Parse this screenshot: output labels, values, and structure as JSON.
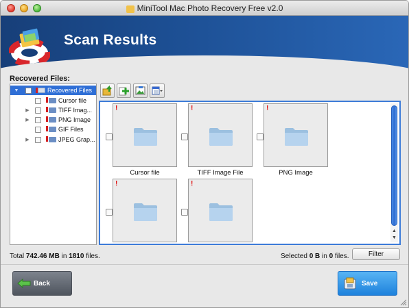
{
  "window": {
    "title": "MiniTool Mac Photo Recovery Free v2.0"
  },
  "banner": {
    "title": "Scan Results"
  },
  "recovered_files_label": "Recovered Files:",
  "tree": {
    "items": [
      {
        "label": "Recovered Files",
        "expanded": true,
        "selected": true
      },
      {
        "label": "Cursor file",
        "expandable": false
      },
      {
        "label": "TIFF Imag...",
        "expandable": true
      },
      {
        "label": "PNG Image",
        "expandable": true
      },
      {
        "label": "GIF Files",
        "expandable": false
      },
      {
        "label": "JPEG Grap...",
        "expandable": true
      }
    ]
  },
  "toolbar": {
    "buttons": [
      "up-folder-icon",
      "add-icon",
      "image-preview-icon",
      "view-options-icon"
    ]
  },
  "grid": {
    "items": [
      {
        "label": "Cursor file"
      },
      {
        "label": "TIFF Image File"
      },
      {
        "label": "PNG Image"
      },
      {
        "label": ""
      },
      {
        "label": ""
      }
    ]
  },
  "status": {
    "total_prefix": "Total ",
    "total_size": "742.46 MB",
    "total_mid": " in ",
    "total_count": "1810",
    "total_suffix": " files.",
    "selected_prefix": "Selected ",
    "selected_size": "0 B",
    "selected_mid": " in ",
    "selected_count": "0",
    "selected_suffix": " files."
  },
  "buttons": {
    "filter": "Filter",
    "back": "Back",
    "save": "Save"
  },
  "colors": {
    "accent": "#2f6fd6",
    "banner": "#1c4e92",
    "save": "#1e82dc"
  }
}
